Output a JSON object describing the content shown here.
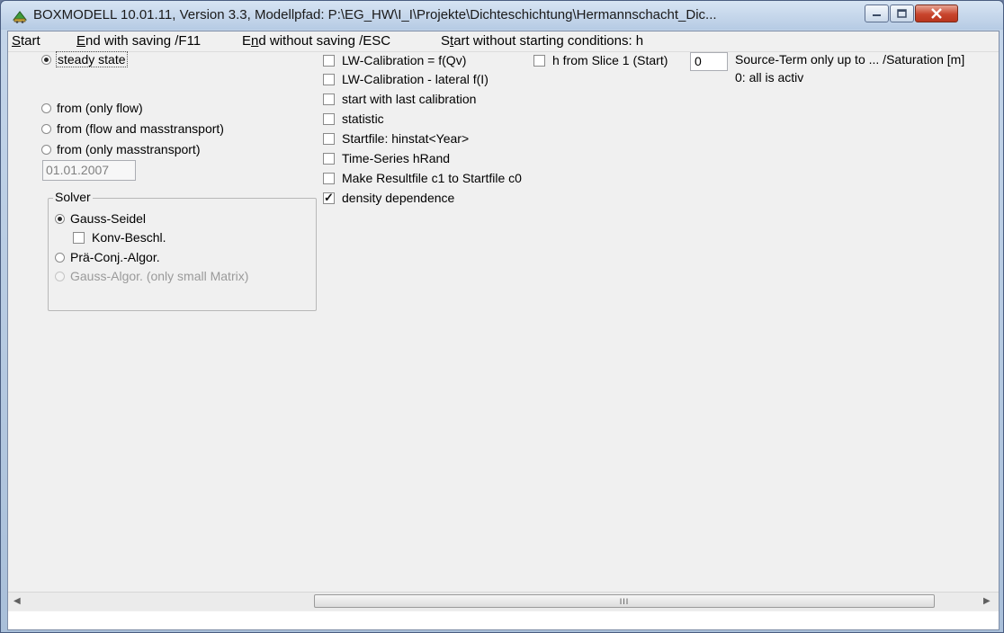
{
  "window": {
    "title": "BOXMODELL 10.01.11, Version 3.3, Modellpfad:  P:\\EG_HW\\I_I\\Projekte\\Dichteschichtung\\Hermannschacht_Dic..."
  },
  "menu": {
    "start": {
      "u": "S",
      "rest": "tart"
    },
    "end_saving": {
      "u": "E",
      "rest": "nd with saving /F11"
    },
    "end_no_saving": {
      "pre": "E",
      "u": "n",
      "rest": "d without saving /ESC"
    },
    "start_no_cond": {
      "pre": "S",
      "u": "t",
      "rest": "art without starting conditions: h"
    }
  },
  "mode": {
    "steady_state": "steady state",
    "from_flow": "from (only flow)",
    "from_flow_mass": "from (flow and masstransport)",
    "from_mass": "from (only masstransport)",
    "date": "01.01.2007",
    "selected": "steady_state"
  },
  "solver": {
    "title": "Solver",
    "gauss_seidel": "Gauss-Seidel",
    "konv": "Konv-Beschl.",
    "pra": "Prä-Conj.-Algor.",
    "gauss_algor": "Gauss-Algor. (only small Matrix)"
  },
  "options": {
    "lw_cal_qv": "LW-Calibration = f(Qv)",
    "lw_cal_lat": "LW-Calibration - lateral f(I)",
    "last_cal": "start with last calibration",
    "statistic": "statistic",
    "startfile": "Startfile: hinstat<Year>",
    "timeseries": "Time-Series hRand",
    "resultfile": "Make Resultfile c1 to Startfile c0",
    "density": "density dependence",
    "h_slice": "h from Slice 1 (Start)"
  },
  "source_term": {
    "value": "0",
    "label": "Source-Term only up to ... /Saturation [m]",
    "note": "0: all is activ"
  },
  "scrollbar": {
    "grip": "III"
  },
  "colors": {
    "accent": "#c8452d",
    "frame": "#a9bfd9"
  }
}
